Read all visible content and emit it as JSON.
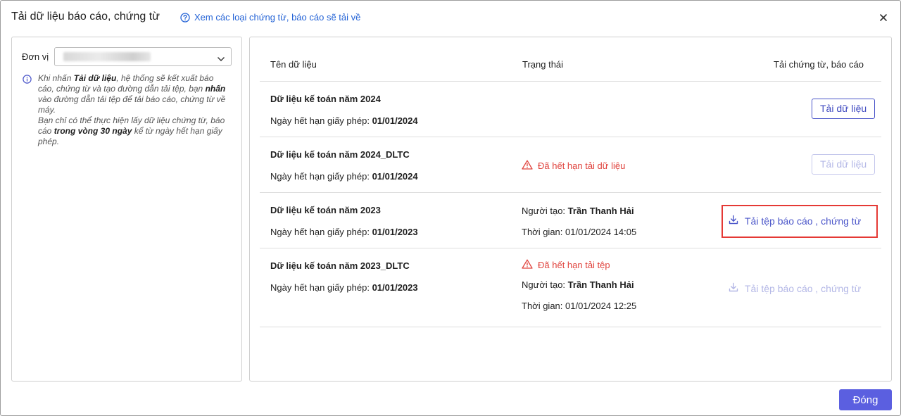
{
  "dialog": {
    "title": "Tải dữ liệu báo cáo, chứng từ",
    "help_link": "Xem các loại chứng từ, báo cáo sẽ tải về",
    "close_label": "×"
  },
  "left": {
    "unit_label": "Đơn vị",
    "info": {
      "p1_a": "Khi nhấn ",
      "p1_b": "Tải dữ liệu",
      "p1_c": ", hệ thống sẽ kết xuất báo cáo, chứng từ và tạo đường dẫn tải tệp, bạn ",
      "p1_d": "nhấn",
      "p1_e": " vào đường dẫn tải tệp để tải báo cáo, chứng từ về máy.",
      "p2_a": "Bạn chỉ có thể thực hiện lấy dữ liệu chứng từ, báo cáo ",
      "p2_b": "trong vòng 30 ngày",
      "p2_c": " kể từ ngày hết hạn giấy phép."
    }
  },
  "table": {
    "headers": {
      "name": "Tên dữ liệu",
      "status": "Trạng thái",
      "download": "Tải chứng từ, báo cáo"
    },
    "rows": [
      {
        "name": "Dữ liệu kế toán năm 2024",
        "exp_label": "Ngày hết hạn giấy phép: ",
        "exp_date": "01/01/2024",
        "action": "Tải dữ liệu"
      },
      {
        "name": "Dữ liệu kế toán năm 2024_DLTC",
        "exp_label": "Ngày hết hạn giấy phép: ",
        "exp_date": "01/01/2024",
        "warning": "Đã hết hạn tải dữ liệu",
        "action": "Tải dữ liệu"
      },
      {
        "name": "Dữ liệu kế toán năm 2023",
        "exp_label": "Ngày hết hạn giấy phép: ",
        "exp_date": "01/01/2023",
        "creator_label": "Người tạo: ",
        "creator": "Trần Thanh Hải",
        "time_label": "Thời gian: ",
        "time": "01/01/2024 14:05",
        "action": "Tải tệp báo cáo , chứng từ"
      },
      {
        "name": "Dữ liệu kế toán năm 2023_DLTC",
        "exp_label": "Ngày hết hạn giấy phép: ",
        "exp_date": "01/01/2023",
        "warning": "Đã hết hạn tải tệp",
        "creator_label": "Người tạo: ",
        "creator": "Trần Thanh Hải",
        "time_label": "Thời gian: ",
        "time": "01/01/2024 12:25",
        "action": "Tải tệp báo cáo , chứng từ"
      }
    ]
  },
  "footer": {
    "close_button": "Đóng"
  },
  "colors": {
    "primary": "#5b5fe0",
    "link": "#2463d6",
    "warning": "#e0443e",
    "highlight": "#e53935"
  },
  "icons": [
    "help-circle-icon",
    "close-icon",
    "chevron-down-icon",
    "info-icon",
    "warning-triangle-icon",
    "download-icon"
  ]
}
